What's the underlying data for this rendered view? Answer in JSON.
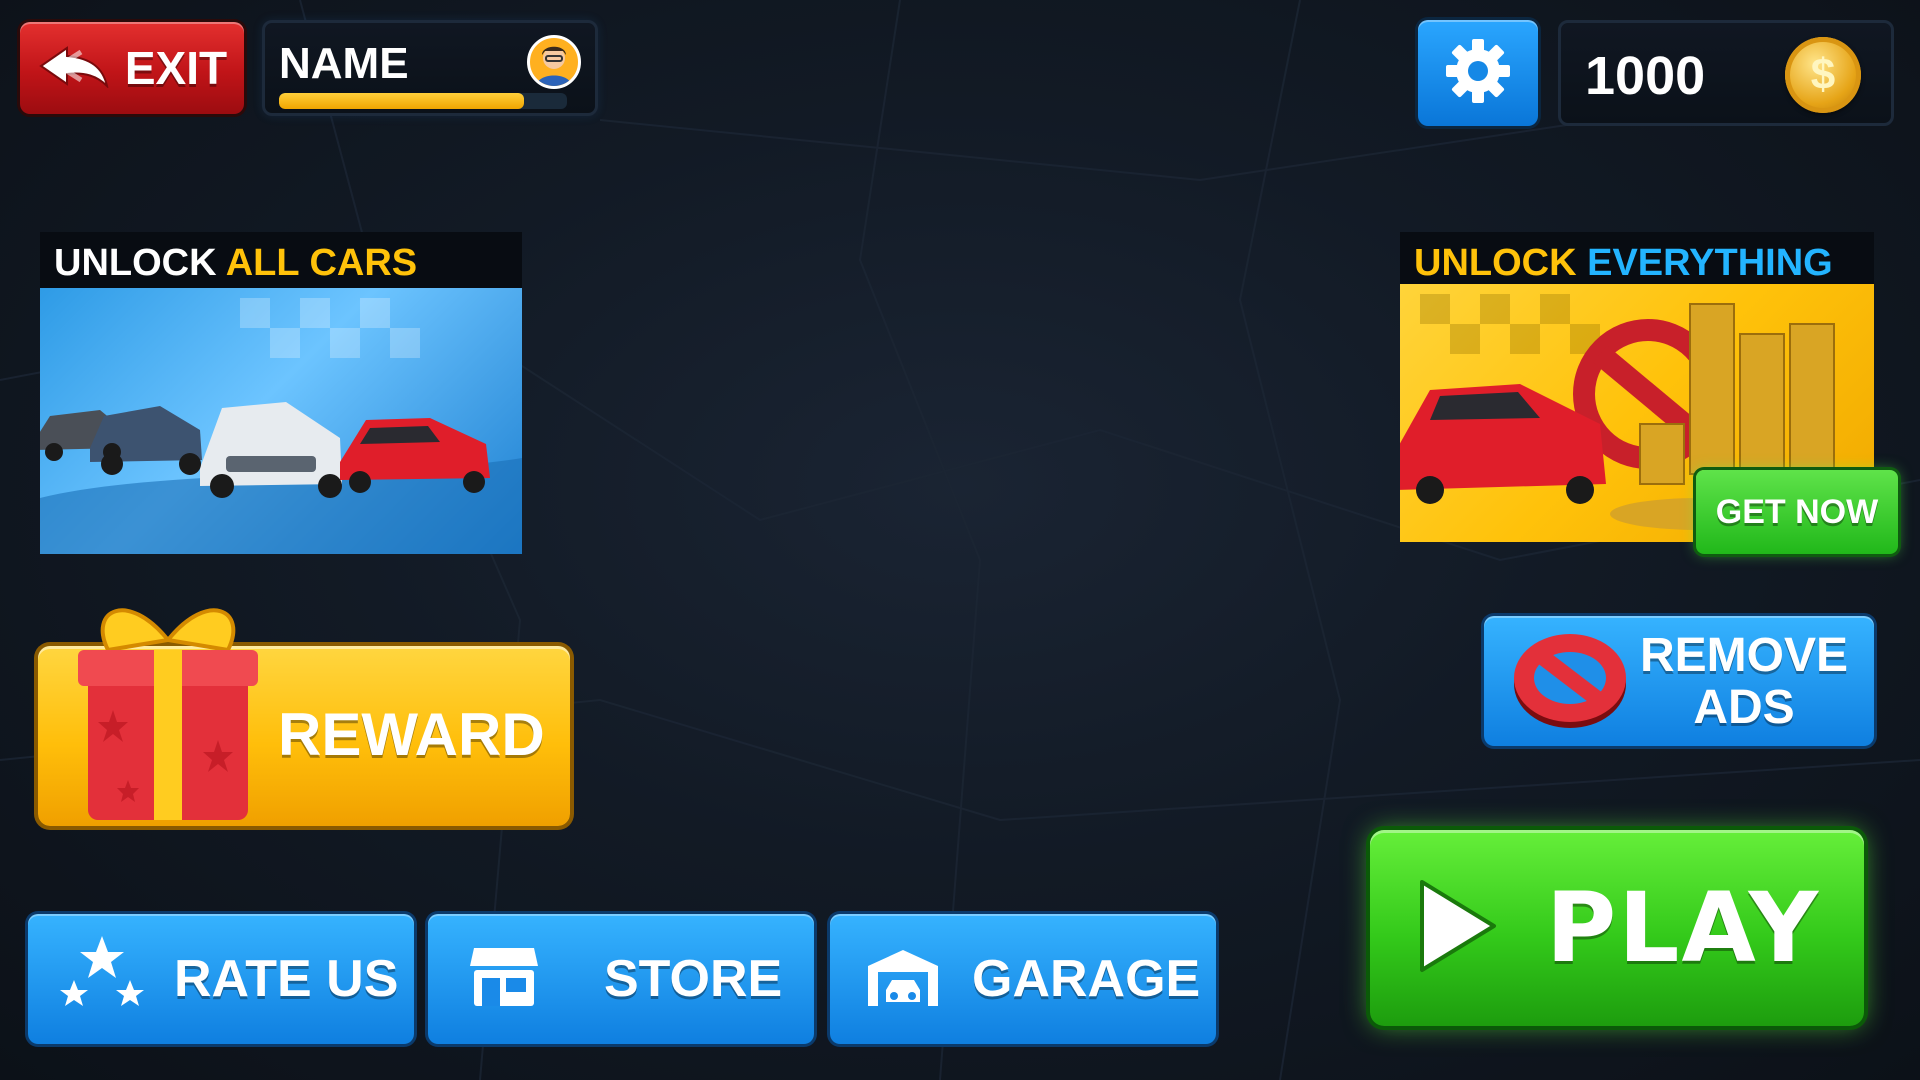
{
  "topbar": {
    "exit_label": "EXIT",
    "name_label": "NAME",
    "xp_progress": 0.85,
    "coins": "1000"
  },
  "promos": {
    "unlock_cars": {
      "word1": "UNLOCK",
      "word2": "ALL CARS"
    },
    "unlock_everything": {
      "word1": "UNLOCK",
      "word2": "EVERYTHING"
    },
    "get_now_label": "GET NOW"
  },
  "buttons": {
    "reward": "REWARD",
    "remove_ads_line1": "REMOVE",
    "remove_ads_line2": "ADS",
    "rate_us": "RATE US",
    "store": "STORE",
    "garage": "GARAGE",
    "play": "PLAY"
  },
  "icons": {
    "exit": "back-arrow-icon",
    "avatar": "avatar-icon",
    "settings": "gear-icon",
    "coin": "coin-icon",
    "gift": "gift-icon",
    "no_ads": "prohibited-icon",
    "rate": "stars-icon",
    "store": "shop-icon",
    "garage": "garage-icon",
    "play": "play-triangle-icon"
  },
  "colors": {
    "accent_yellow": "#ffc20a",
    "accent_blue": "#1f9af0",
    "accent_green": "#33c91a",
    "exit_red": "#c01418",
    "title_cyan": "#23b4ff"
  }
}
